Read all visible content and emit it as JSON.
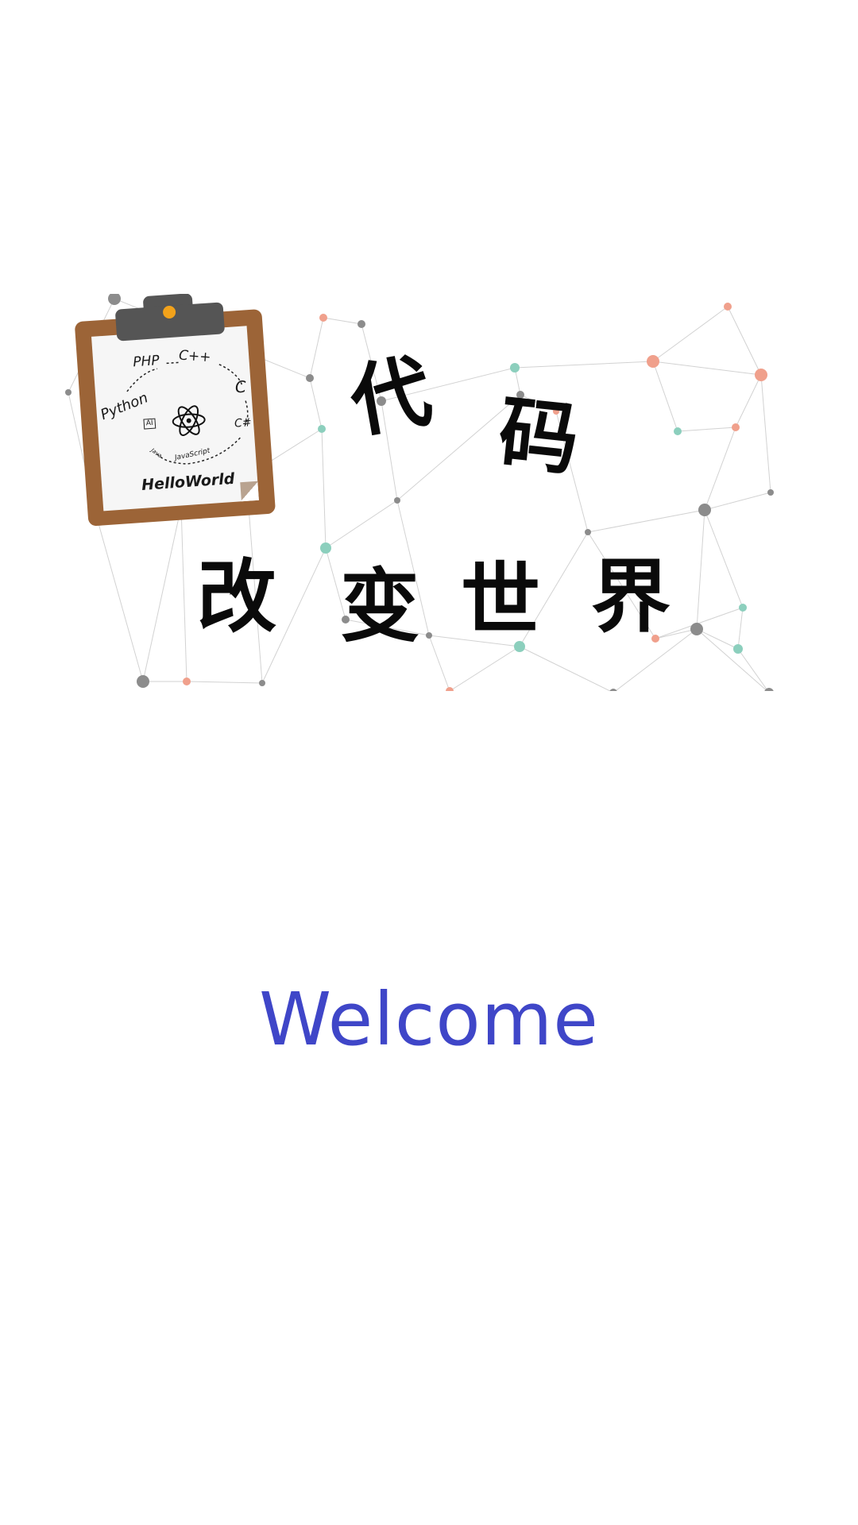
{
  "banner": {
    "title_line1": [
      "代",
      "码"
    ],
    "title_line2": [
      "改",
      "变",
      "世",
      "界"
    ],
    "clipboard": {
      "languages": {
        "python": "Python",
        "php": "PHP",
        "cpp": "C++",
        "c": "C",
        "csharp": "C#",
        "javascript": "JavaScript",
        "java": "Java",
        "ai": "AI"
      },
      "footer": "HelloWorld"
    },
    "colors": {
      "title": "#0a0a0a",
      "board": "#9c6437",
      "clip": "#555555",
      "clip_dot": "#f2a21b",
      "node_gray": "#8c8c8c",
      "node_teal": "#8ccfbd",
      "node_salmon": "#f0a08c"
    }
  },
  "welcome": {
    "text": "Welcome",
    "color": "#3f46c8"
  }
}
